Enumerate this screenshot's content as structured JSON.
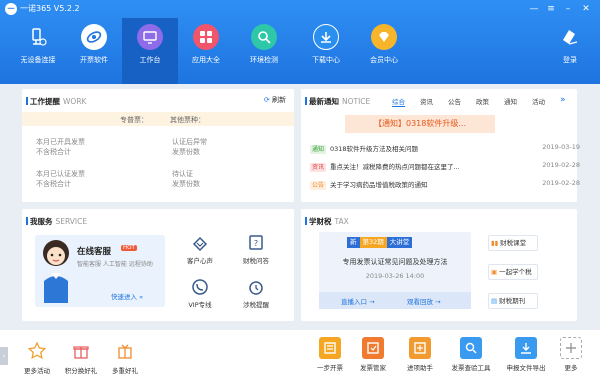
{
  "app": {
    "logo": "一",
    "title": "一诺365 V5.2.2"
  },
  "nav": [
    {
      "label": "无设备连接",
      "icon": "device-icon"
    },
    {
      "label": "开票软件",
      "icon": "invoice-software-icon"
    },
    {
      "label": "工作台",
      "icon": "workbench-icon"
    },
    {
      "label": "应用大全",
      "icon": "apps-icon"
    },
    {
      "label": "环境检测",
      "icon": "env-check-icon"
    },
    {
      "label": "下载中心",
      "icon": "download-icon"
    },
    {
      "label": "会员中心",
      "icon": "vip-icon"
    }
  ],
  "login": {
    "label": "登录"
  },
  "work": {
    "title": "工作提醒",
    "title_en": "WORK",
    "refresh": "刷新",
    "col1": "专普票：",
    "col2": "其他票种：",
    "items": [
      {
        "a": "本月已开具发票",
        "b": "不含税合计"
      },
      {
        "a": "认证后异常",
        "b": "发票份数"
      },
      {
        "a": "本月已认证发票",
        "b": "不含税合计"
      },
      {
        "a": "待认证",
        "b": "发票份数"
      }
    ]
  },
  "notice": {
    "title": "最新通知",
    "title_en": "NOTICE",
    "tabs": [
      "综合",
      "资讯",
      "公告",
      "政策",
      "通知",
      "活动"
    ],
    "banner": "【通知】0318软件升级...",
    "rows": [
      {
        "tag": "通知",
        "text": "0318软件升级方法及相关问题",
        "date": "2019-03-19"
      },
      {
        "tag": "资讯",
        "text": "重点关注！减税降费的热点问题都在这里了...",
        "date": "2019-02-28"
      },
      {
        "tag": "公告",
        "text": "关于学习病药品增值税政策的通知",
        "date": "2019-02-28"
      }
    ]
  },
  "service": {
    "title": "我服务",
    "title_en": "SERVICE",
    "online": "在线客服",
    "hot": "HOT",
    "desc": "智能客服 人工智能 远程协助",
    "enter": "快速进入 »",
    "items": [
      "客户心声",
      "财税问答",
      "VIP专线",
      "涉税提醒"
    ]
  },
  "tax": {
    "title": "学财税",
    "title_en": "TAX",
    "badge1": "新",
    "badge2": "第32期",
    "badge3": "大讲堂",
    "subtitle": "专用发票认证常见问题及处理方法",
    "date": "2019-03-26 14:00",
    "live": "直播入口 →",
    "replay": "观看回放 →",
    "links": [
      "财税课堂",
      "一起学个税",
      "财税期刊"
    ]
  },
  "bottom": [
    {
      "label": "更多活动",
      "color": "#f0a030"
    },
    {
      "label": "积分换好礼",
      "color": "#e86060"
    },
    {
      "label": "多重好礼",
      "color": "#f08c30"
    },
    {
      "label": "一步开票",
      "color": "#f5a623"
    },
    {
      "label": "发票管家",
      "color": "#f07a30"
    },
    {
      "label": "进项助手",
      "color": "#f09a30"
    },
    {
      "label": "发票查验工具",
      "color": "#3a9af0"
    },
    {
      "label": "申报文件导出",
      "color": "#3a9af0"
    },
    {
      "label": "更多",
      "color": "#cccccc"
    }
  ]
}
